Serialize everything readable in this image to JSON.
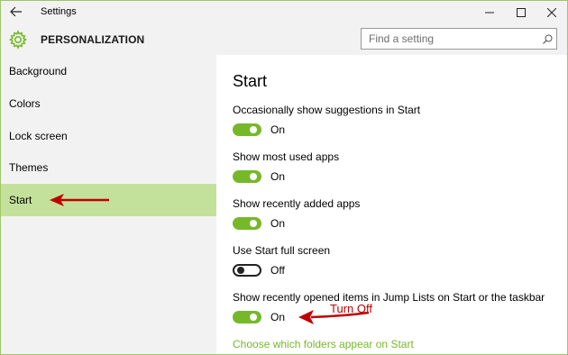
{
  "window": {
    "title": "Settings"
  },
  "header": {
    "title": "PERSONALIZATION",
    "search_placeholder": "Find a setting"
  },
  "sidebar": {
    "items": [
      {
        "label": "Background"
      },
      {
        "label": "Colors"
      },
      {
        "label": "Lock screen"
      },
      {
        "label": "Themes"
      },
      {
        "label": "Start",
        "selected": true
      }
    ]
  },
  "main": {
    "section_title": "Start",
    "settings": [
      {
        "label": "Occasionally show suggestions in Start",
        "state": "On"
      },
      {
        "label": "Show most used apps",
        "state": "On"
      },
      {
        "label": "Show recently added apps",
        "state": "On"
      },
      {
        "label": "Use Start full screen",
        "state": "Off"
      },
      {
        "label": "Show recently opened items in Jump Lists on Start or the taskbar",
        "state": "On"
      }
    ],
    "link": "Choose which folders appear on Start"
  },
  "annotation": {
    "text": "Turn Off"
  },
  "colors": {
    "accent": "#76b82a",
    "selected_bg": "#c4e19c",
    "annotation": "#c00000"
  }
}
